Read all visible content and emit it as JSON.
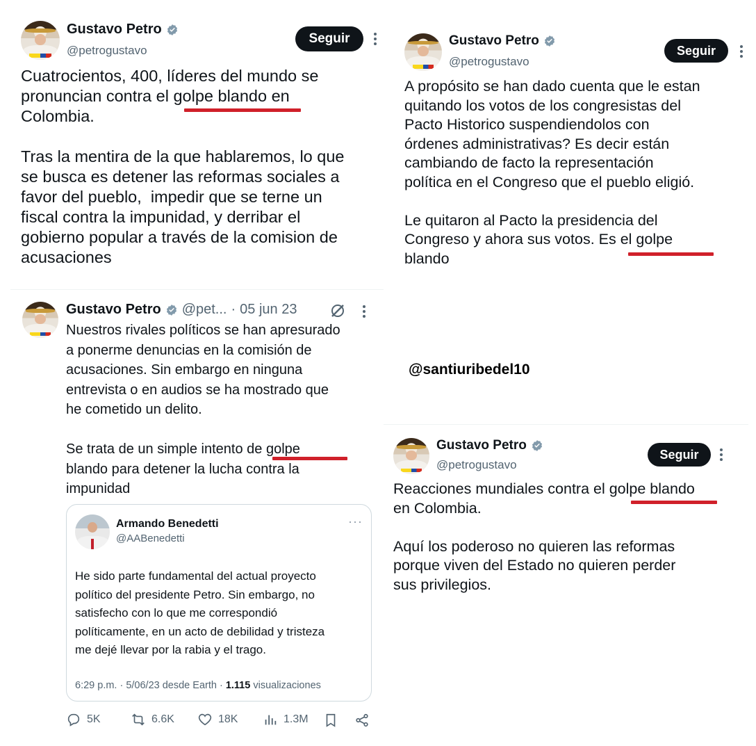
{
  "credit": "@santiuribedel10",
  "tweet1": {
    "author": "Gustavo Petro",
    "handle": "@petrogustavo",
    "follow_label": "Seguir",
    "text": "Cuatrocientos, 400, líderes del mundo se\npronuncian contra el golpe blando en\nColombia.\n\nTras la mentira de la que hablaremos, lo que\nse busca es detener las reformas sociales a\nfavor del pueblo,  impedir que se terne un\nfiscal contra la impunidad, y derribar el\ngobierno popular a través de la comision de\nacusaciones"
  },
  "tweet2": {
    "author": "Gustavo Petro",
    "handle": "@pet...",
    "date": "05 jun 23",
    "separator": "·",
    "text": "Nuestros rivales políticos se han apresurado\na ponerme denuncias en la comisión de\nacusaciones. Sin embargo en ninguna\nentrevista o en audios se ha mostrado que\nhe cometido un delito.\n\nSe trata de un simple intento de golpe\nblando para detener la lucha contra la\nimpunidad",
    "quote": {
      "author": "Armando Benedetti",
      "handle": "@AABenedetti",
      "more": "···",
      "text": "He sido parte fundamental del actual proyecto\npolítico del presidente Petro. Sin embargo, no\nsatisfecho con lo que me correspondió\npolíticamente, en un acto de debilidad y tristeza\nme dejé llevar por la rabia y el trago.",
      "meta": "6:29 p.m. · 5/06/23 desde Earth · ",
      "views_count": "1.115",
      "views_label": " visualizaciones"
    },
    "actions": {
      "replies": "5K",
      "retweets": "6.6K",
      "likes": "18K",
      "views": "1.3M"
    }
  },
  "tweet3": {
    "author": "Gustavo Petro",
    "handle": "@petrogustavo",
    "follow_label": "Seguir",
    "text": "A propósito se han dado cuenta que le estan\nquitando los votos de los congresistas del\nPacto Historico suspendiendolos con\nórdenes administrativas? Es decir están\ncambiando de facto la representación\npolítica en el Congreso que el pueblo eligió.\n\nLe quitaron al Pacto la presidencia del\nCongreso y ahora sus votos. Es el golpe\nblando"
  },
  "tweet4": {
    "author": "Gustavo Petro",
    "handle": "@petrogustavo",
    "follow_label": "Seguir",
    "text": "Reacciones mundiales contra el golpe blando\nen Colombia.\n\nAquí los poderoso no quieren las reformas\nporque viven del Estado no quieren perder\nsus privilegios."
  },
  "colors": {
    "highlight_underline": "#d0202a",
    "follow_bg": "#0f1419",
    "verified": "#829aab",
    "secondary_text": "#536471"
  }
}
